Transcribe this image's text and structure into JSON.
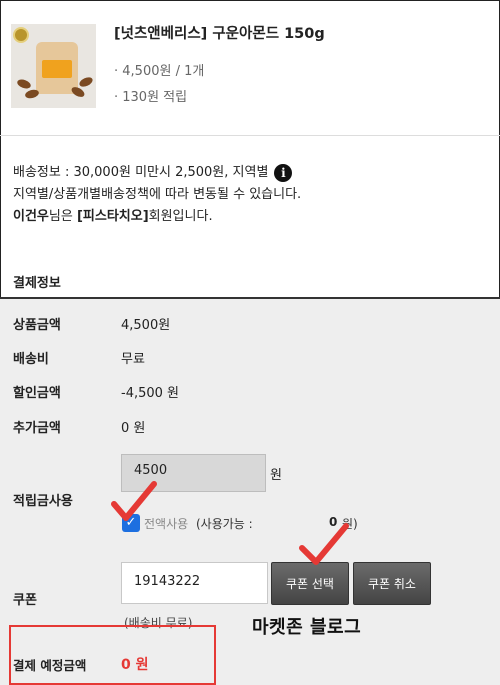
{
  "product": {
    "title": "[넛츠앤베리스] 구운아몬드 150g",
    "price_qty": "· 4,500원 / 1개",
    "points": "· 130원 적립"
  },
  "shipping": {
    "line1": "배송정보 : 30,000원 미만시 2,500원, 지역별",
    "info_icon": "i",
    "line2": "지역별/상품개별배송정책에 따라 변동될 수 있습니다.",
    "member_name": "이건우",
    "member_mid": "님은 ",
    "member_grade": "[피스타치오]",
    "member_tail": "회원입니다."
  },
  "payment": {
    "heading": "결제정보",
    "rows": [
      {
        "label": "상품금액",
        "value": "4,500원"
      },
      {
        "label": "배송비",
        "value": "무료"
      },
      {
        "label": "할인금액",
        "value": "-4,500 원"
      },
      {
        "label": "추가금액",
        "value": "0 원"
      }
    ],
    "points_label": "적립금사용",
    "points_input": "4500",
    "points_unit": "원",
    "use_all_checked": true,
    "use_all_label": "전액사용",
    "available_label": "(사용가능 :",
    "available_value": "0",
    "available_unit": "원)",
    "coupon_label": "쿠폰",
    "coupon_input": "19143222",
    "coupon_select_button": "쿠폰 선택",
    "coupon_cancel_button": "쿠폰 취소",
    "coupon_note": "(배송비 무료)",
    "total_label": "결제 예정금액",
    "total_value": "0 원"
  },
  "overlay": {
    "watermark": "마켓존 블로그",
    "highlight_color": "#e53935"
  }
}
